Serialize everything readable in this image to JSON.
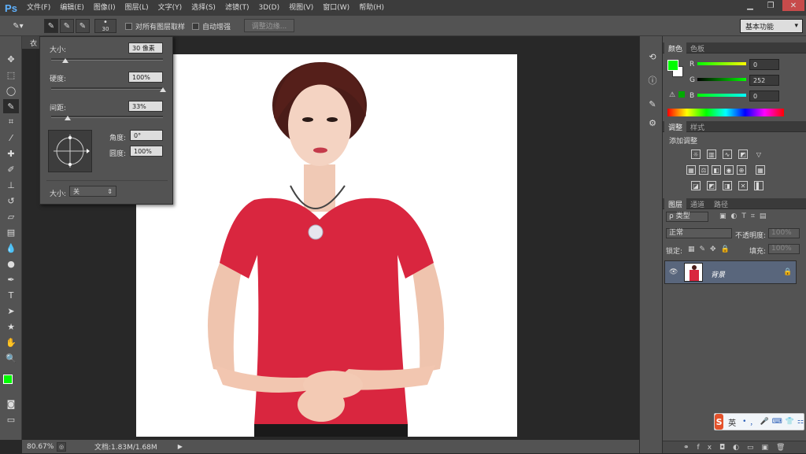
{
  "app": {
    "logo": "Ps"
  },
  "menu": [
    "文件(F)",
    "编辑(E)",
    "图像(I)",
    "图层(L)",
    "文字(Y)",
    "选择(S)",
    "滤镜(T)",
    "3D(D)",
    "视图(V)",
    "窗口(W)",
    "帮助(H)"
  ],
  "window_controls": {
    "minimize": "▁",
    "restore": "❐",
    "close": "✕"
  },
  "options": {
    "brush_size": "30",
    "sample_all_layers": "对所有图层取样",
    "auto_enhance": "自动增强",
    "refine_edge": "调整边缘...",
    "workspace": "基本功能"
  },
  "document": {
    "tab_label": "衣"
  },
  "status": {
    "zoom": "80.67%",
    "doc_info": "文档:1.83M/1.68M"
  },
  "brush_popup": {
    "size_label": "大小:",
    "size_value": "30 像素",
    "hardness_label": "硬度:",
    "hardness_value": "100%",
    "spacing_label": "间距:",
    "spacing_value": "33%",
    "angle_label": "角度:",
    "angle_value": "0°",
    "roundness_label": "圆度:",
    "roundness_value": "100%",
    "size_ctrl_label": "大小:",
    "size_ctrl_value": "关",
    "size_pct": 0.13,
    "hardness_pct": 1.0,
    "spacing_pct": 0.15
  },
  "color_panel": {
    "tabs": [
      "颜色",
      "色板"
    ],
    "r_label": "R",
    "r_value": "0",
    "g_label": "G",
    "g_value": "252",
    "b_label": "B",
    "b_value": "0",
    "fg_color": "#00fc00",
    "bg_color": "#ffffff"
  },
  "adjust_panel": {
    "tabs": [
      "调整",
      "样式"
    ],
    "title": "添加调整"
  },
  "layers_panel": {
    "tabs": [
      "图层",
      "通道",
      "路径"
    ],
    "filter_kind": "ρ 类型",
    "blend_mode": "正常",
    "opacity_label": "不透明度:",
    "opacity_value": "100%",
    "lock_label": "锁定:",
    "fill_label": "填充:",
    "fill_value": "100%",
    "layer_name": "背景"
  },
  "ime": {
    "logo": "S",
    "lang": "英",
    "symbols": [
      "•",
      "，",
      "🎤",
      "⌨",
      "👕",
      "⚏"
    ]
  }
}
